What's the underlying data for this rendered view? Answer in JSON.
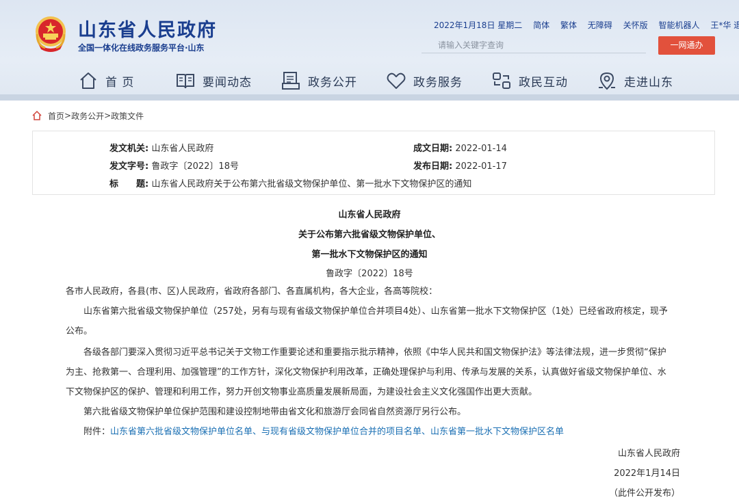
{
  "site": {
    "title": "山东省人民政府",
    "subtitle": "全国一体化在线政务服务平台·山东"
  },
  "toplinks": [
    "2022年1月18日 星期二",
    "简体",
    "繁体",
    "无障碍",
    "关怀版",
    "智能机器人",
    "王*华 退出"
  ],
  "search": {
    "placeholder": "请输入关键字查询",
    "button": "一网通办"
  },
  "nav": [
    "首 页",
    "要闻动态",
    "政务公开",
    "政务服务",
    "政民互动",
    "走进山东"
  ],
  "breadcrumb": [
    "首页",
    "政务公开",
    "政策文件"
  ],
  "info": {
    "issuer_key": "发文机关:",
    "issuer": "山东省人民政府",
    "date_made_key": "成文日期:",
    "date_made": "2022-01-14",
    "docno_key": "发文字号:",
    "docno": "鲁政字〔2022〕18号",
    "date_pub_key": "发布日期:",
    "date_pub": "2022-01-17",
    "title_key": "标　　题:",
    "title": "山东省人民政府关于公布第六批省级文物保护单位、第一批水下文物保护区的通知"
  },
  "article": {
    "head1": "山东省人民政府",
    "head2": "关于公布第六批省级文物保护单位、",
    "head3": "第一批水下文物保护区的通知",
    "docno": "鲁政字〔2022〕18号",
    "recipients": "各市人民政府，各县(市、区)人民政府，省政府各部门、各直属机构，各大企业，各高等院校：",
    "p1": "山东省第六批省级文物保护单位（257处，另有与现有省级文物保护单位合并项目4处）、山东省第一批水下文物保护区（1处）已经省政府核定，现予公布。",
    "p2": "各级各部门要深入贯彻习近平总书记关于文物工作重要论述和重要指示批示精神，依照《中华人民共和国文物保护法》等法律法规，进一步贯彻“保护为主、抢救第一、合理利用、加强管理”的工作方针，深化文物保护利用改革，正确处理保护与利用、传承与发展的关系，认真做好省级文物保护单位、水下文物保护区的保护、管理和利用工作，努力开创文物事业高质量发展新局面，为建设社会主义文化强国作出更大贡献。",
    "p3": "第六批省级文物保护单位保护范围和建设控制地带由省文化和旅游厅会同省自然资源厅另行公布。",
    "attach_label": "附件：",
    "attachments": "山东省第六批省级文物保护单位名单、与现有省级文物保护单位合并的项目名单、山东省第一批水下文物保护区名单",
    "sign_org": "山东省人民政府",
    "sign_date": "2022年1月14日",
    "sign_note": "（此件公开发布）"
  },
  "colors": {
    "brand": "#1a3e8f",
    "accent_red": "#e2513c",
    "link": "#1a6fb3"
  }
}
